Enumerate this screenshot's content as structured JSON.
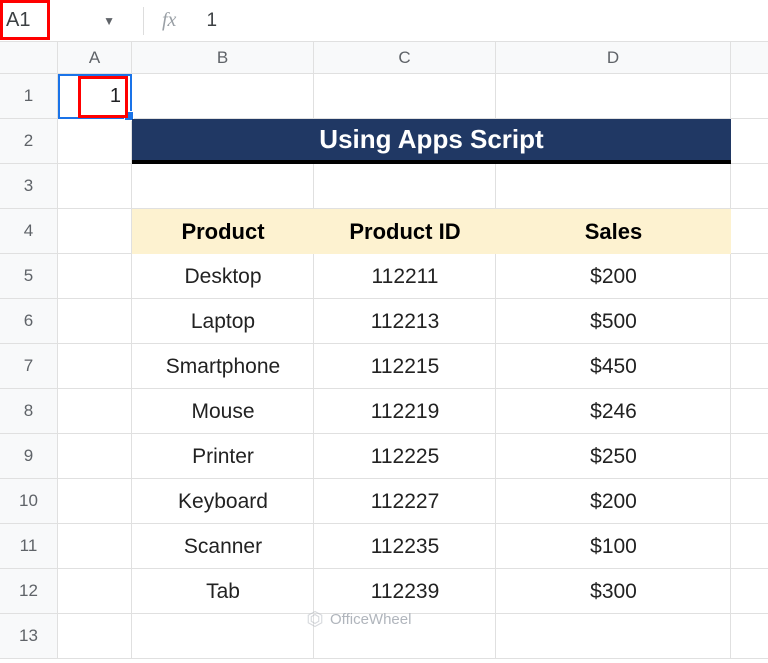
{
  "formula_bar": {
    "cell_ref": "A1",
    "fx_label": "fx",
    "value": "1"
  },
  "columns": [
    "A",
    "B",
    "C",
    "D"
  ],
  "row_numbers": [
    "1",
    "2",
    "3",
    "4",
    "5",
    "6",
    "7",
    "8",
    "9",
    "10",
    "11",
    "12",
    "13"
  ],
  "a1_value": "1",
  "title": "Using Apps Script",
  "table": {
    "headers": [
      "Product",
      "Product ID",
      "Sales"
    ],
    "rows": [
      {
        "product": "Desktop",
        "id": "112211",
        "sales": "$200"
      },
      {
        "product": "Laptop",
        "id": "112213",
        "sales": "$500"
      },
      {
        "product": "Smartphone",
        "id": "112215",
        "sales": "$450"
      },
      {
        "product": "Mouse",
        "id": "112219",
        "sales": "$246"
      },
      {
        "product": "Printer",
        "id": "112225",
        "sales": "$250"
      },
      {
        "product": "Keyboard",
        "id": "112227",
        "sales": "$200"
      },
      {
        "product": "Scanner",
        "id": "112235",
        "sales": "$100"
      },
      {
        "product": "Tab",
        "id": "112239",
        "sales": "$300"
      }
    ]
  },
  "watermark": "OfficeWheel",
  "colors": {
    "title_bg": "#203864",
    "header_bg": "#fdf2d0",
    "selection": "#1a73e8",
    "highlight": "#ff0000"
  }
}
